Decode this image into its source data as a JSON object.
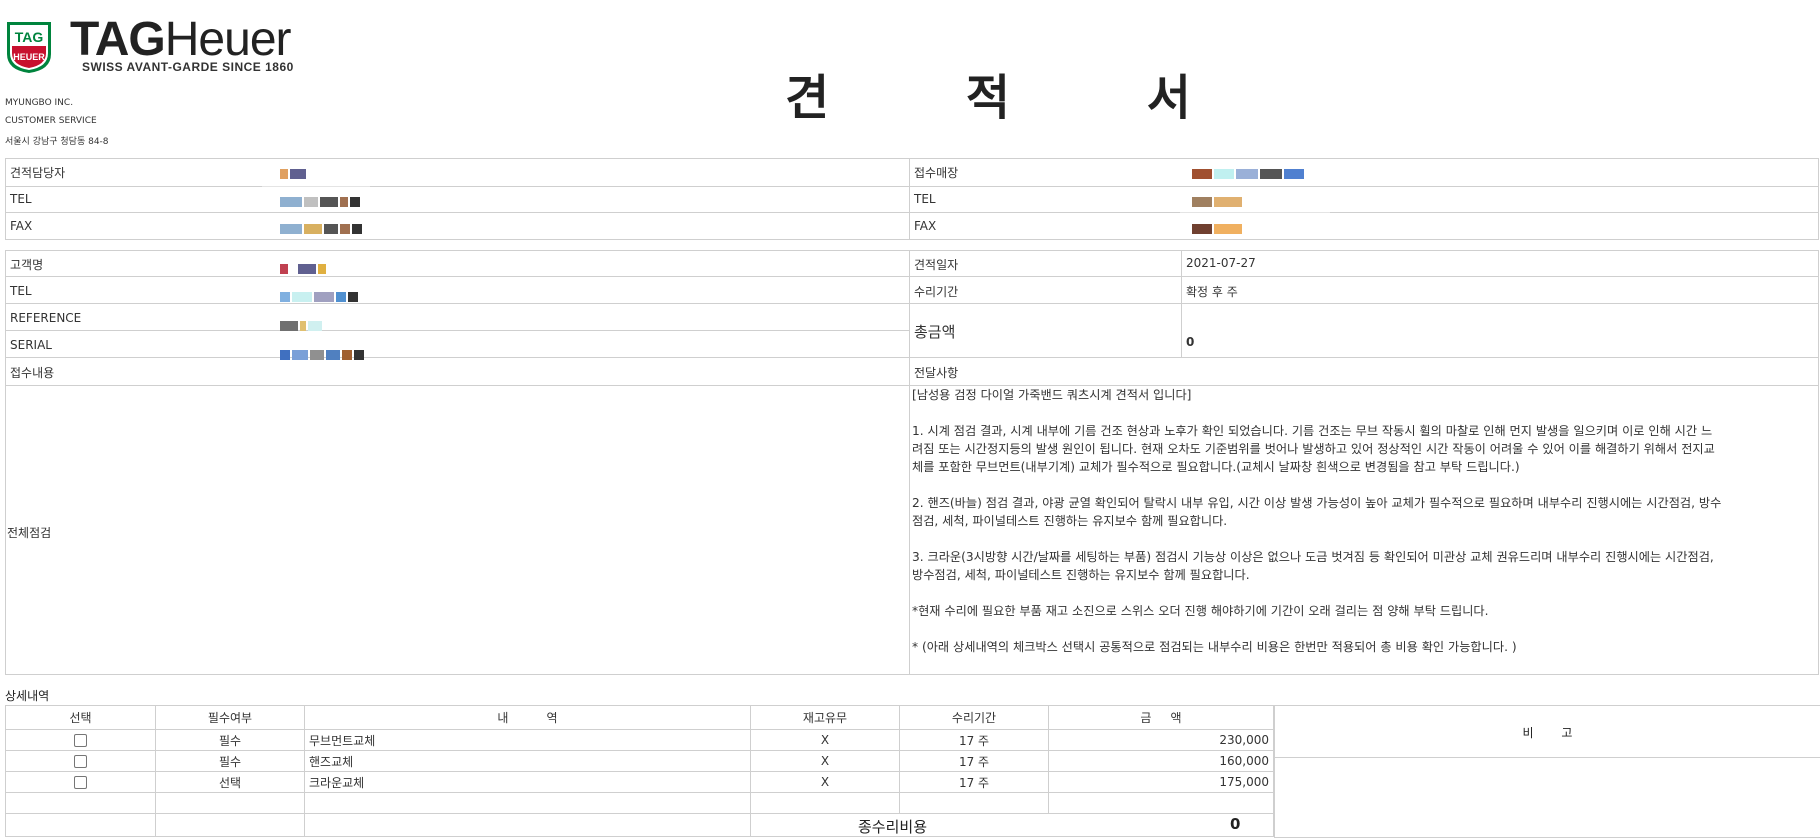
{
  "header": {
    "logo_badge": "TAG HEUER",
    "brand_bold": "TAG",
    "brand_light": "Heuer",
    "tagline": "SWISS AVANT-GARDE SINCE 1860",
    "company_lines": [
      "MYUNGBO INC.",
      "CUSTOMER SERVICE",
      "서울시 강남구 청담동 84-8"
    ],
    "doc_title": "견 적 서"
  },
  "info1": {
    "left": [
      {
        "label": "견적담당자"
      },
      {
        "label": "TEL"
      },
      {
        "label": "FAX"
      }
    ],
    "right": [
      {
        "label": "접수매장"
      },
      {
        "label": "TEL"
      },
      {
        "label": "FAX"
      }
    ]
  },
  "info2": {
    "left": [
      {
        "label": "고객명"
      },
      {
        "label": "TEL"
      },
      {
        "label": "REFERENCE"
      },
      {
        "label": "SERIAL"
      }
    ],
    "right": {
      "date_label": "견적일자",
      "date_value": "2021-07-27",
      "period_label": "수리기간",
      "period_value": "확정 후 주",
      "total_label": "총금액",
      "total_value": "0"
    }
  },
  "section": {
    "reception_label": "접수내용",
    "message_label": "전달사항",
    "inspection_label": "전체점검",
    "notes": "[남성용 검정 다이얼 가죽밴드 쿼츠시계 견적서 입니다]\n\n1. 시계 점검 결과, 시계 내부에 기름 건조 현상과 노후가 확인 되었습니다. 기름 건조는 무브 작동시 휠의 마찰로 인해 먼지 발생을 일으키며 이로 인해 시간 느\n려짐 또는 시간정지등의 발생 원인이 됩니다. 현재 오차도 기준범위를 벗어나 발생하고 있어 정상적인 시간 작동이 어려울 수 있어 이를 해결하기 위해서 전지교\n체를 포함한 무브먼트(내부기계) 교체가 필수적으로 필요합니다.(교체시 날짜창 흰색으로 변경됨을 참고 부탁 드립니다.)\n\n2. 핸즈(바늘) 점검 결과, 야광 균열 확인되어 탈락시 내부 유입, 시간 이상 발생 가능성이 높아 교체가 필수적으로 필요하며 내부수리 진행시에는 시간점검, 방수\n점검, 세척, 파이널테스트 진행하는 유지보수 함께 필요합니다.\n\n3. 크라운(3시방향 시간/날짜를 세팅하는 부품) 점검시 기능상 이상은 없으나 도금 벗겨짐 등 확인되어 미관상 교체 권유드리며 내부수리 진행시에는 시간점검,\n방수점검, 세척, 파이널테스트 진행하는 유지보수 함께 필요합니다.\n\n*현재 수리에 필요한 부품 재고 소진으로 스위스 오더 진행 해야하기에 기간이 오래 걸리는 점 양해 부탁 드립니다.\n\n* (아래 상세내역의 체크박스 선택시 공통적으로 점검되는 내부수리 비용은 한번만 적용되어 총 비용 확인 가능합니다. )"
  },
  "detail": {
    "label": "상세내역",
    "headers": [
      "선택",
      "필수여부",
      "내          역",
      "재고유무",
      "수리기간",
      "금     액"
    ],
    "rows": [
      {
        "required": "필수",
        "item": "무브먼트교체",
        "stock": "X",
        "period": "17 주",
        "amount": "230,000"
      },
      {
        "required": "필수",
        "item": "핸즈교체",
        "stock": "X",
        "period": "17 주",
        "amount": "160,000"
      },
      {
        "required": "선택",
        "item": "크라운교체",
        "stock": "X",
        "period": "17 주",
        "amount": "175,000"
      }
    ],
    "remarks_label": "비   고",
    "total_label": "종수리비용",
    "total_value": "0"
  },
  "colors": {
    "border": "#cfcfcf",
    "brand_red": "#c8102e",
    "brand_green": "#00843d"
  }
}
